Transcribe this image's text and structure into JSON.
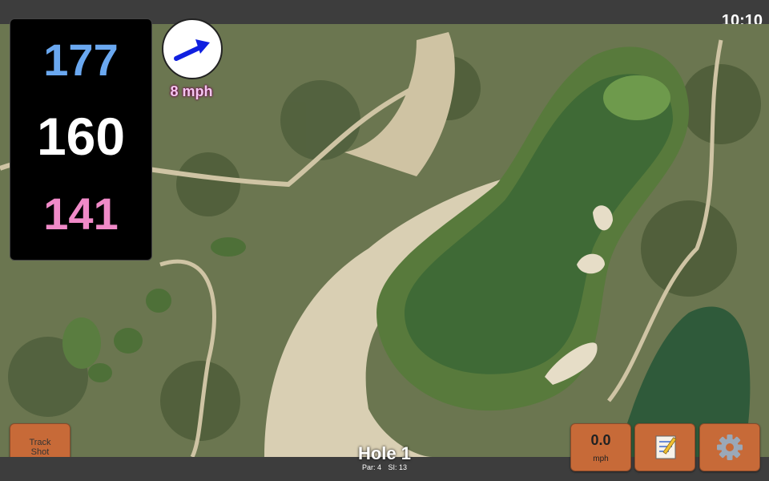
{
  "status": {
    "time": "10:10"
  },
  "yardages": {
    "back": "177",
    "middle": "160",
    "front": "141"
  },
  "wind": {
    "speed_label": "8 mph",
    "icon": "wind-arrow-icon"
  },
  "buttons": {
    "track_shot": {
      "line1": "Track",
      "line2": "Shot"
    },
    "speed": {
      "value": "0.0",
      "unit": "mph"
    },
    "notes": {
      "icon": "notepad-icon"
    },
    "settings": {
      "icon": "gear-icon"
    }
  },
  "hole": {
    "title": "Hole 1",
    "par_label": "Par: 4",
    "si_label": "SI: 13"
  },
  "colors": {
    "back": "#6aa8f0",
    "middle": "#ffffff",
    "front": "#f08ac8",
    "button": "#c76a38"
  }
}
